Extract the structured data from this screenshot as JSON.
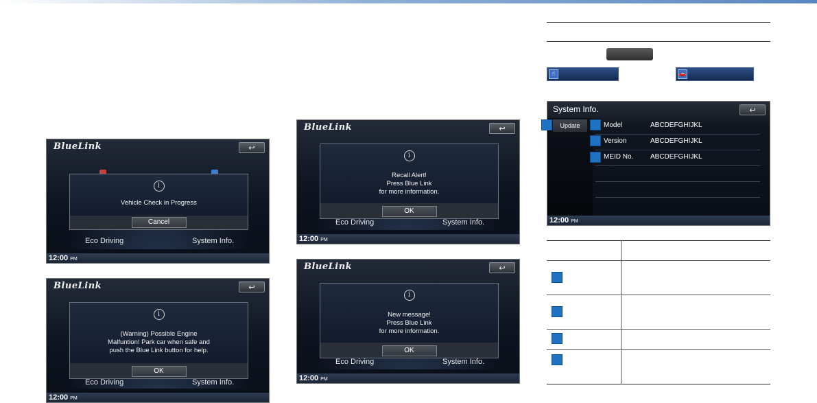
{
  "app": {
    "logo_text": "BlueLink",
    "clock_time": "12:00",
    "clock_period": "PM",
    "back_glyph": "↩"
  },
  "screens": {
    "vehicle_check": {
      "menu_left": "Eco Driving",
      "menu_right": "System Info.",
      "message": "Vehicle Check in Progress",
      "button": "Cancel"
    },
    "warning": {
      "menu_left": "Eco Driving",
      "menu_right": "System Info.",
      "message_lines": [
        "(Warning) Possible Engine",
        "Malfuntion! Park car when safe and",
        "push the Blue Link button for help."
      ],
      "button": "OK"
    },
    "recall": {
      "menu_left": "Eco Driving",
      "menu_right": "System Info.",
      "message_lines": [
        "Recall Alert!",
        "Press Blue Link",
        "for more information."
      ],
      "button": "OK"
    },
    "new_message": {
      "menu_left": "Eco Driving",
      "menu_right": "System Info.",
      "message_lines": [
        "New message!",
        "Press Blue Link",
        "for more information."
      ],
      "button": "OK"
    },
    "system_info": {
      "title": "System Info.",
      "update_button": "Update",
      "rows": [
        {
          "label": "Model",
          "value": "ABCDEFGHIJKL"
        },
        {
          "label": "Version",
          "value": "ABCDEFGHIJKL"
        },
        {
          "label": "MEID No.",
          "value": "ABCDEFGHIJKL"
        }
      ]
    }
  },
  "colors": {
    "marker_blue": "#1f73c2",
    "screen_bg": "#0d1420",
    "bar_blue": "#2d4f86"
  },
  "icons": {
    "info": "info-circle-icon",
    "back": "back-arrow-icon",
    "bluelink_bar_icon": "hand-icon",
    "car_bar_icon": "car-icon"
  }
}
